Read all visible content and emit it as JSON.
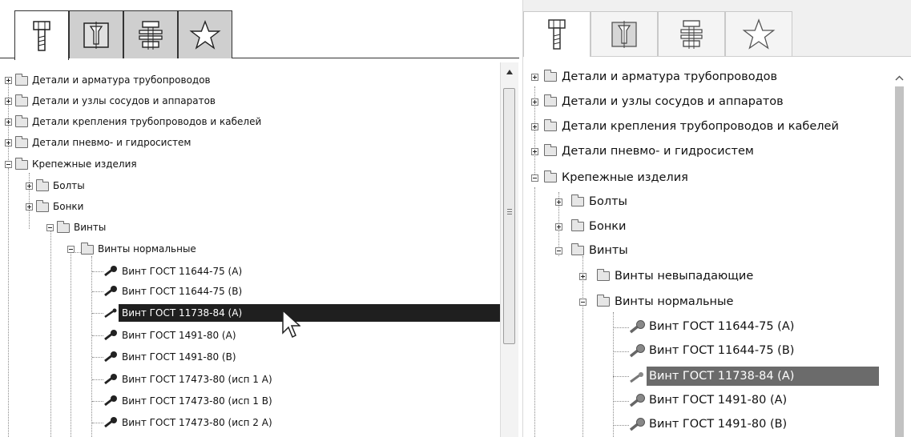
{
  "tabs": [
    {
      "id": "fasteners",
      "icon": "bolt-icon"
    },
    {
      "id": "drawings",
      "icon": "countersink-icon"
    },
    {
      "id": "assemblies",
      "icon": "bolt-nut-assembly-icon"
    },
    {
      "id": "favorites",
      "icon": "star-icon"
    }
  ],
  "tree": [
    {
      "label": "Детали и арматура трубопроводов"
    },
    {
      "label": "Детали и узлы сосудов и аппаратов"
    },
    {
      "label": "Детали крепления трубопроводов и кабелей"
    },
    {
      "label": "Детали пневмо- и гидросистем"
    },
    {
      "label": "Крепежные изделия"
    },
    {
      "label": "Болты"
    },
    {
      "label": "Бонки"
    },
    {
      "label": "Винты"
    },
    {
      "label": "Винты невыпадающие"
    },
    {
      "label": "Винты  нормальные"
    },
    {
      "label": "Винты нормальные"
    },
    {
      "label": "Винт ГОСТ 11644-75 (А)"
    },
    {
      "label": "Винт ГОСТ 11644-75 (В)"
    },
    {
      "label": "Винт ГОСТ 11738-84 (А)"
    },
    {
      "label": "Винт ГОСТ 1491-80 (А)"
    },
    {
      "label": "Винт ГОСТ 1491-80 (В)"
    },
    {
      "label": "Винт ГОСТ 17473-80 (исп 1 А)"
    },
    {
      "label": "Винт ГОСТ 17473-80 (исп 1 В)"
    },
    {
      "label": "Винт ГОСТ 17473-80 (исп 2 А)"
    }
  ],
  "colors": {
    "selection_left": "#1f1f1f",
    "selection_right": "#6b6b6b"
  }
}
